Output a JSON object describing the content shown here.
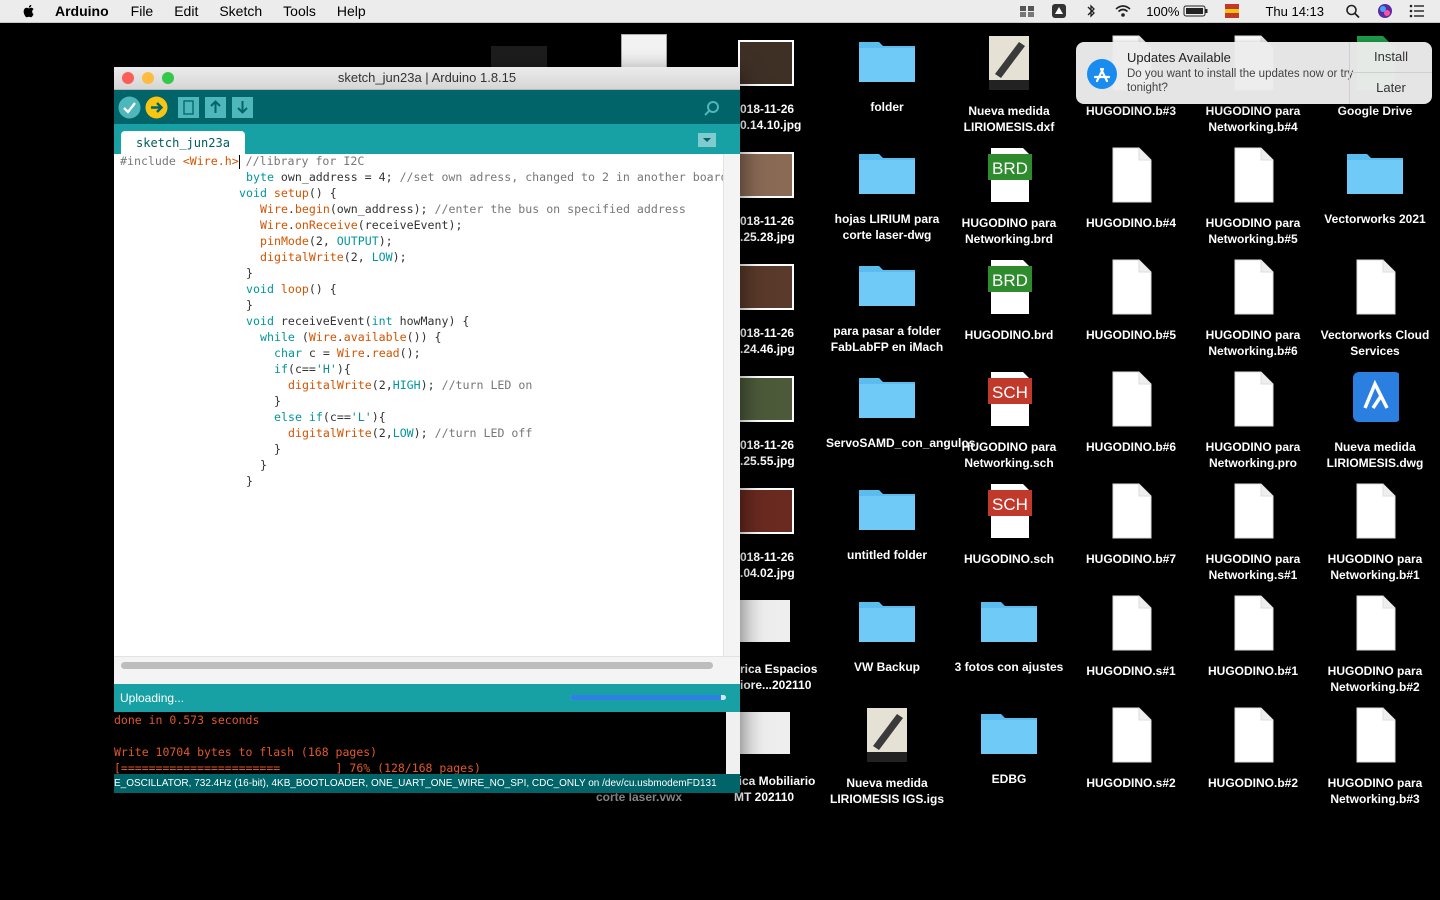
{
  "menubar": {
    "app": "Arduino",
    "items": [
      "File",
      "Edit",
      "Sketch",
      "Tools",
      "Help"
    ],
    "battery": "100%",
    "clock": "Thu 14:13"
  },
  "notification": {
    "title": "Updates Available",
    "body": "Do you want to install the updates now or try tonight?",
    "install": "Install",
    "later": "Later"
  },
  "window": {
    "title": "sketch_jun23a | Arduino 1.8.15",
    "tab": "sketch_jun23a",
    "status": "Uploading...",
    "progress": 0.97,
    "console": [
      "done in 0.573 seconds",
      "",
      "Write 10704 bytes to flash (168 pages)",
      "[=======================        ] 76% (128/168 pages)"
    ],
    "board": "E_OSCILLATOR, 732.4Hz (16-bit), 4KB_BOOTLOADER, ONE_UART_ONE_WIRE_NO_SPI, CDC_ONLY on /dev/cu.usbmodemFD131"
  },
  "code": [
    {
      "t": "#include <Wire.h>",
      "c": "//library for I2C"
    },
    {
      "t": "byte own_address = 4;",
      "c": "//set own adress, changed to 2 in another board"
    },
    {
      "t": "void setup() {",
      "c": ""
    },
    {
      "t": "Wire.begin(own_address);",
      "c": "//enter the bus on specified address"
    },
    {
      "t": "Wire.onReceive(receiveEvent);",
      "c": ""
    },
    {
      "t": "pinMode(2, OUTPUT);",
      "c": ""
    },
    {
      "t": "digitalWrite(2, LOW);",
      "c": ""
    },
    {
      "t": "}",
      "c": ""
    },
    {
      "t": "void loop() {",
      "c": ""
    },
    {
      "t": "}",
      "c": ""
    },
    {
      "t": "void receiveEvent(int howMany) {",
      "c": ""
    },
    {
      "t": "while (Wire.available()) {",
      "c": ""
    },
    {
      "t": "char c = Wire.read();",
      "c": ""
    },
    {
      "t": "if(c=='H'){",
      "c": ""
    },
    {
      "t": "digitalWrite(2,HIGH);",
      "c": "//turn LED on"
    },
    {
      "t": "}",
      "c": ""
    },
    {
      "t": "else if(c=='L'){",
      "c": ""
    },
    {
      "t": "digitalWrite(2,LOW);",
      "c": "//turn LED off"
    },
    {
      "t": "}",
      "c": ""
    },
    {
      "t": "}",
      "c": ""
    },
    {
      "t": "}",
      "c": ""
    }
  ],
  "desktop": [
    {
      "label": "folder",
      "kind": "folder"
    },
    {
      "label": "Nueva medida LIRIOMESIS.dxf",
      "kind": "strata"
    },
    {
      "label": "HUGODINO.b#3",
      "kind": "doc"
    },
    {
      "label": "HUGODINO para Networking.b#4",
      "kind": "doc"
    },
    {
      "label": "Google Drive",
      "kind": "drive"
    },
    {
      "label": "hojas LIRIUM para corte laser-dwg",
      "kind": "folder"
    },
    {
      "label": "HUGODINO para Networking.brd",
      "kind": "brd"
    },
    {
      "label": "HUGODINO.b#4",
      "kind": "doc"
    },
    {
      "label": "HUGODINO para Networking.b#5",
      "kind": "doc"
    },
    {
      "label": "Vectorworks 2021",
      "kind": "folder"
    },
    {
      "label": "para pasar a folder FabLabFP en iMach",
      "kind": "folder"
    },
    {
      "label": "HUGODINO.brd",
      "kind": "brd"
    },
    {
      "label": "HUGODINO.b#5",
      "kind": "doc"
    },
    {
      "label": "HUGODINO para Networking.b#6",
      "kind": "doc"
    },
    {
      "label": "Vectorworks Cloud Services",
      "kind": "doc"
    },
    {
      "label": "ServoSAMD_con_angulos",
      "kind": "folder"
    },
    {
      "label": "HUGODINO para Networking.sch",
      "kind": "sch"
    },
    {
      "label": "HUGODINO.b#6",
      "kind": "doc"
    },
    {
      "label": "HUGODINO para Networking.pro",
      "kind": "doc"
    },
    {
      "label": "Nueva medida LIRIOMESIS.dwg",
      "kind": "dwg"
    },
    {
      "label": "untitled folder",
      "kind": "folder"
    },
    {
      "label": "HUGODINO.sch",
      "kind": "sch"
    },
    {
      "label": "HUGODINO.b#7",
      "kind": "doc"
    },
    {
      "label": "HUGODINO para Networking.s#1",
      "kind": "doc"
    },
    {
      "label": "HUGODINO para Networking.b#1",
      "kind": "doc"
    },
    {
      "label": "VW Backup",
      "kind": "folder"
    },
    {
      "label": "3 fotos con ajustes",
      "kind": "folder"
    },
    {
      "label": "HUGODINO.s#1",
      "kind": "doc"
    },
    {
      "label": "HUGODINO.b#1",
      "kind": "doc"
    },
    {
      "label": "HUGODINO para Networking.b#2",
      "kind": "doc"
    },
    {
      "label": "Nueva medida LIRIOMESIS IGS.igs",
      "kind": "strata"
    },
    {
      "label": "EDBG",
      "kind": "folder"
    },
    {
      "label": "HUGODINO.s#2",
      "kind": "doc"
    },
    {
      "label": "HUGODINO.b#2",
      "kind": "doc"
    },
    {
      "label": "HUGODINO para Networking.b#3",
      "kind": "doc"
    }
  ],
  "partial_items": [
    {
      "label": "018-11-26\n0.14.10.jpg"
    },
    {
      "label": "018-11-26\n.25.28.jpg"
    },
    {
      "label": "018-11-26\n.24.46.jpg"
    },
    {
      "label": "018-11-26\n.25.55.jpg"
    },
    {
      "label": "018-11-26\n.04.02.jpg"
    },
    {
      "label": "rica Espacios\niore...202110"
    },
    {
      "label": "rica Mobiliario\nMT 202110"
    },
    {
      "label": "corte laser.vwx"
    }
  ]
}
